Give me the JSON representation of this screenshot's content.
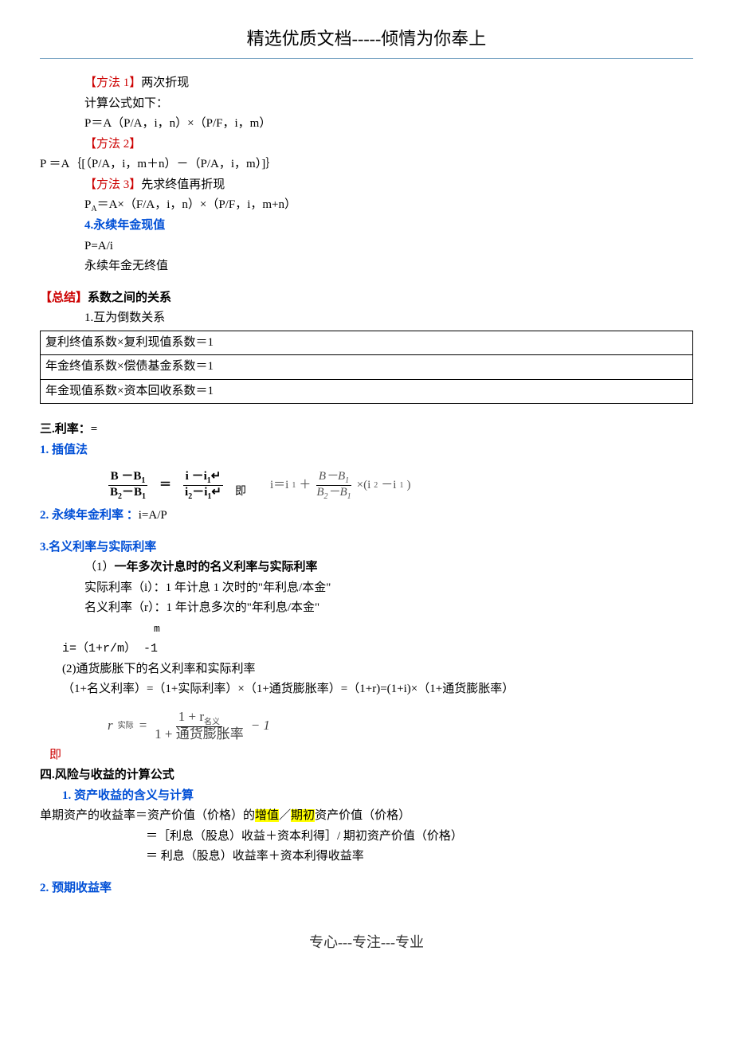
{
  "header": "精选优质文档-----倾情为你奉上",
  "footer": "专心---专注---专业",
  "lines": {
    "m1": "【方法 1】",
    "m1b": "两次折现",
    "calc": "计算公式如下：",
    "pa1": "P＝A（P/A，i，n）×（P/F，i，m）",
    "m2": "【方法 2】",
    "pa2": "P ＝A｛[（P/A，i，m＋n）－（P/A，i，m）]｝",
    "m3": "【方法 3】",
    "m3b": "先求终值再折现",
    "pa3": "P",
    "pa3a": "A",
    "pa3rest": "＝A×（F/A，i，n）×（P/F，i，m+n）",
    "h4": "4.永续年金现值",
    "pai": "P=A/i",
    "noend": "永续年金无终值",
    "sum_pre": "【总结】",
    "sum_rest": "系数之间的关系",
    "recip": "1.互为倒数关系"
  },
  "table": [
    "复利终值系数×复利现值系数＝1",
    "年金终值系数×偿债基金系数＝1",
    "年金现值系数×资本回收系数＝1"
  ],
  "sec3": {
    "title": "三.利率：=",
    "h1": "1. 插值法",
    "eq1_n1": "B －B",
    "eq1_d1": "B",
    "eq1_d1b": "－B",
    "eq1_n2": "i －i",
    "eq1_d2": "i",
    "eq1_d2b": "－i",
    "eq1_rt": "i＝i",
    "eq1_rt2": "×(i",
    "eq1_rt3": "－i",
    "ji": "即",
    "h2": "2. 永续年金利率 ：",
    "h2v": "i=A/P",
    "h3": "3.名义利率与实际利率",
    "s31a": "（1）",
    "s31b": "一年多次计息时的名义利率与实际利率",
    "s32": "实际利率（i）：1 年计息 1 次时的\"年利息/本金\"",
    "s33": "名义利率（r）：1 年计息多次的\"年利息/本金\"",
    "s34m": "m",
    "s34": "i=（1+r/m）  -1",
    "s35": "(2)通货膨胀下的名义利率和实际利率",
    "s36": "（1+名义利率）=（1+实际利率）×（1+通货膨胀率）=（1+r)=(1+i)×（1+通货膨胀率）",
    "eq2_left": "r",
    "eq2_sub": "实际",
    "eq2_num": "1 + r",
    "eq2_numsub": "名义",
    "eq2_den": "1 + 通货膨胀率",
    "ji2": "即"
  },
  "sec4": {
    "title": "四.风险与收益的计算公式",
    "h1": "1. 资产收益的含义与计算",
    "l1a": "单期资产的收益率＝资产价值（价格）的",
    "l1h1": "增值",
    "l1m": "／",
    "l1h2": "期初",
    "l1b": "资产价值（价格）",
    "l2": "＝［利息（股息）收益＋资本利得］/ 期初资产价值（价格）",
    "l3": "＝ 利息（股息）收益率＋资本利得收益率",
    "h2": "2. 预期收益率"
  }
}
